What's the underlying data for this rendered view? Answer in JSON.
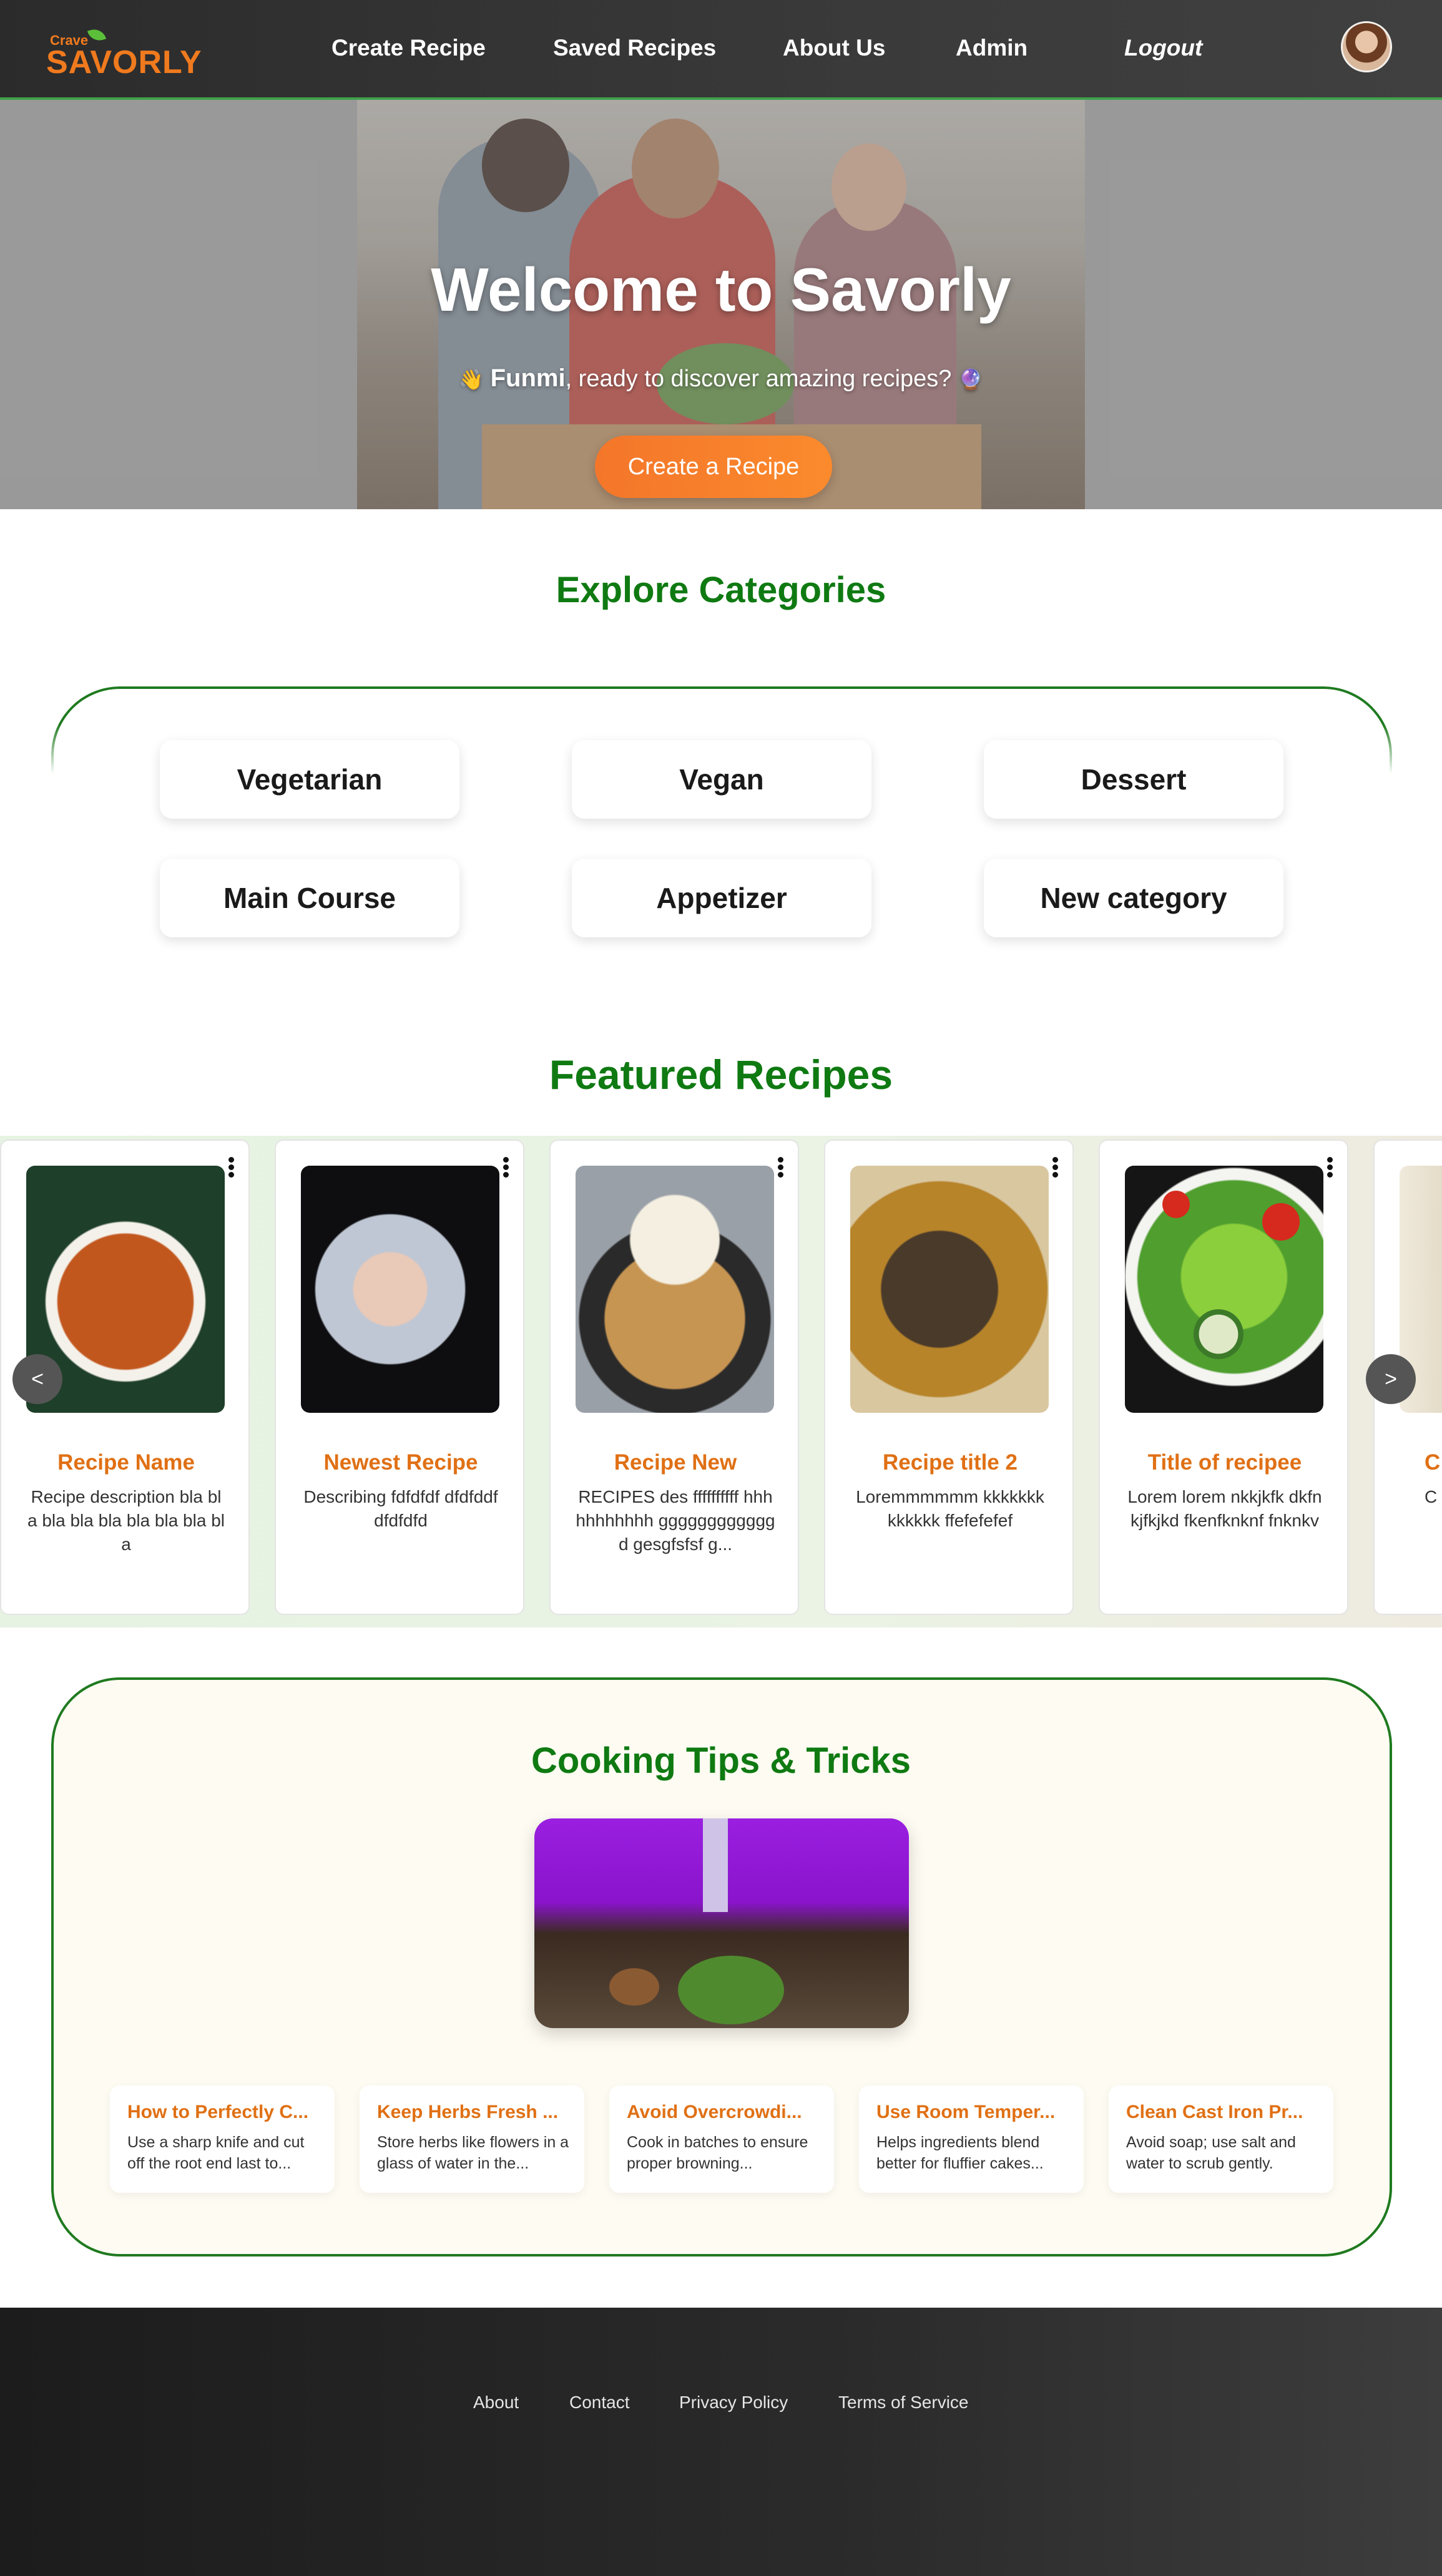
{
  "navbar": {
    "logo_small": "Crave",
    "logo_brand": "SAVORLY",
    "links": [
      "Create Recipe",
      "Saved Recipes",
      "About Us",
      "Admin"
    ],
    "logout": "Logout",
    "accent": "#f07a1e"
  },
  "hero": {
    "title": "Welcome to Savorly",
    "wave_icon": "👋",
    "username": "Funmi",
    "subtitle_rest": ", ready to discover amazing recipes?",
    "sparkle_icon": "🔮",
    "cta": "Create a Recipe"
  },
  "categories": {
    "title": "Explore Categories",
    "items": [
      "Vegetarian",
      "Vegan",
      "Dessert",
      "Main Course",
      "Appetizer",
      "New category"
    ]
  },
  "featured": {
    "title": "Featured Recipes",
    "prev_label": "<",
    "next_label": ">",
    "recipes": [
      {
        "name": "Recipe Name",
        "desc": "Recipe description bla bla bla bla bla bla bla bla bla"
      },
      {
        "name": "Newest Recipe",
        "desc": "Describing fdfdfdf dfdfddf dfdfdfd"
      },
      {
        "name": "Recipe New",
        "desc": "RECIPES des ffffffffff hhhhhhhhhhh ggggggggggggd gesgfsfsf g..."
      },
      {
        "name": "Recipe title 2",
        "desc": "Loremmmmmm kkkkkkk kkkkkk ffefefefef"
      },
      {
        "name": "Title of recipee",
        "desc": "Lorem lorem nkkjkfk dkfnkjfkjkd fkenfknknf fnknkv"
      },
      {
        "name": "C",
        "desc": "C frag ric"
      }
    ]
  },
  "tips": {
    "title": "Cooking Tips & Tricks",
    "items": [
      {
        "title": "How to Perfectly C...",
        "text": "Use a sharp knife and cut off the root end last to..."
      },
      {
        "title": "Keep Herbs Fresh ...",
        "text": "Store herbs like flowers in a glass of water in the..."
      },
      {
        "title": "Avoid Overcrowdi...",
        "text": "Cook in batches to ensure proper browning..."
      },
      {
        "title": "Use Room Temper...",
        "text": "Helps ingredients blend better for fluffier cakes..."
      },
      {
        "title": "Clean Cast Iron Pr...",
        "text": "Avoid soap; use salt and water to scrub gently."
      }
    ]
  },
  "footer": {
    "links": [
      "About",
      "Contact",
      "Privacy Policy",
      "Terms of Service"
    ]
  }
}
